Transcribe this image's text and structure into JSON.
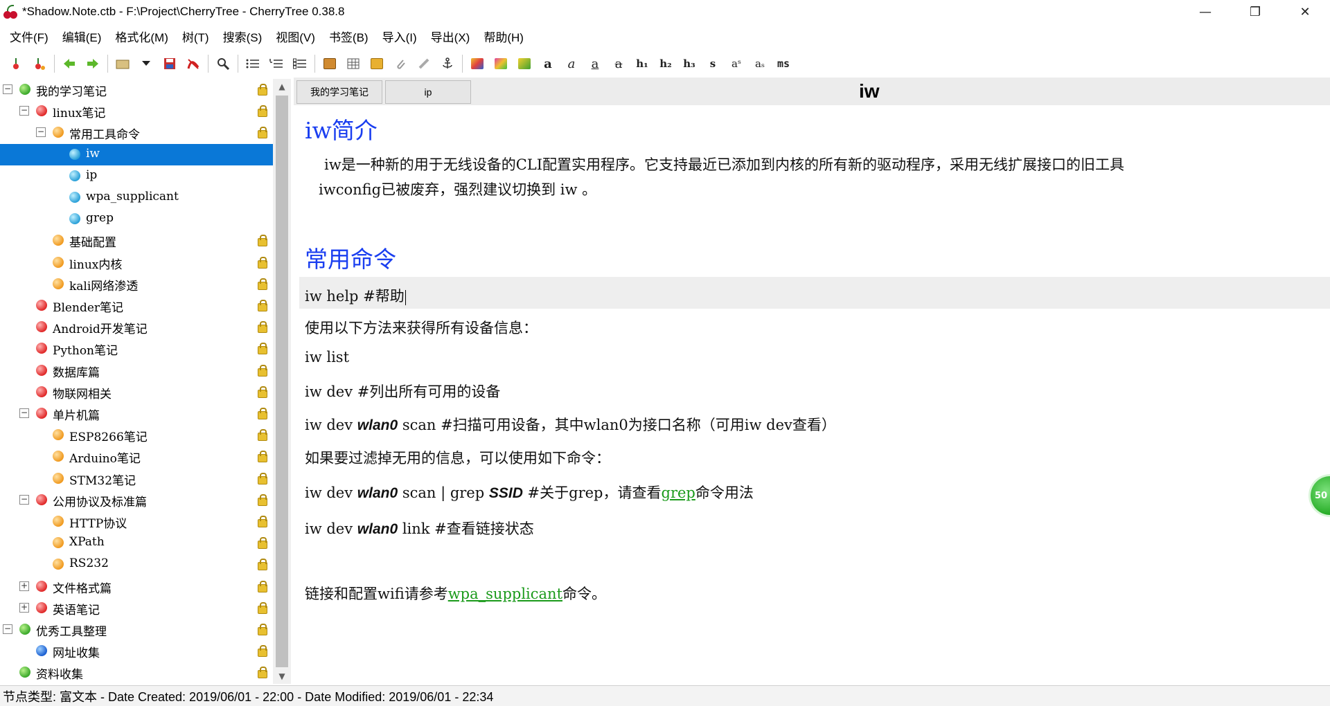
{
  "window": {
    "title": "*Shadow.Note.ctb - F:\\Project\\CherryTree - CherryTree 0.38.8",
    "minimize": "—",
    "restore": "❐",
    "close": "✕"
  },
  "menu": [
    "文件(F)",
    "编辑(E)",
    "格式化(M)",
    "树(T)",
    "搜索(S)",
    "视图(V)",
    "书签(B)",
    "导入(I)",
    "导出(X)",
    "帮助(H)"
  ],
  "toolbar": {
    "icons": [
      "add-node-icon",
      "add-subnode-icon",
      "back-icon",
      "forward-icon",
      "open-icon",
      "dropdown-icon",
      "save-icon",
      "export-pdf-icon",
      "find-icon",
      "bulleted-list-icon",
      "numbered-list-icon",
      "todo-list-icon",
      "image-icon",
      "table-icon",
      "codebox-icon",
      "attach-icon",
      "link-icon",
      "anchor-icon",
      "color-fg-icon",
      "color-bg-icon",
      "remove-format-icon"
    ],
    "format_labels": [
      "a",
      "a",
      "a",
      "a",
      "h₁",
      "h₂",
      "h₃",
      "s",
      "aˢ",
      "aₛ",
      "ms"
    ]
  },
  "tree": [
    {
      "label": "我的学习笔记",
      "icon": "green",
      "level": 0,
      "expander": "⊟",
      "lock": true
    },
    {
      "label": "linux笔记",
      "icon": "red",
      "level": 1,
      "expander": "⊟",
      "lock": true
    },
    {
      "label": "常用工具命令",
      "icon": "orange",
      "level": 2,
      "expander": "⊟",
      "lock": true
    },
    {
      "label": "iw",
      "icon": "teal",
      "level": 3,
      "expander": "",
      "lock": false,
      "selected": true
    },
    {
      "label": "ip",
      "icon": "teal",
      "level": 3,
      "expander": "",
      "lock": false
    },
    {
      "label": "wpa_supplicant",
      "icon": "teal",
      "level": 3,
      "expander": "",
      "lock": false
    },
    {
      "label": "grep",
      "icon": "teal",
      "level": 3,
      "expander": "",
      "lock": false
    },
    {
      "label": "基础配置",
      "icon": "orange",
      "level": 2,
      "expander": "",
      "lock": true
    },
    {
      "label": "linux内核",
      "icon": "orange",
      "level": 2,
      "expander": "",
      "lock": true
    },
    {
      "label": "kali网络渗透",
      "icon": "orange",
      "level": 2,
      "expander": "",
      "lock": true
    },
    {
      "label": "Blender笔记",
      "icon": "red",
      "level": 1,
      "expander": "",
      "lock": true
    },
    {
      "label": "Android开发笔记",
      "icon": "red",
      "level": 1,
      "expander": "",
      "lock": true
    },
    {
      "label": "Python笔记",
      "icon": "red",
      "level": 1,
      "expander": "",
      "lock": true
    },
    {
      "label": "数据库篇",
      "icon": "red",
      "level": 1,
      "expander": "",
      "lock": true
    },
    {
      "label": "物联网相关",
      "icon": "red",
      "level": 1,
      "expander": "",
      "lock": true
    },
    {
      "label": "单片机篇",
      "icon": "red",
      "level": 1,
      "expander": "⊟",
      "lock": true
    },
    {
      "label": "ESP8266笔记",
      "icon": "orange",
      "level": 2,
      "expander": "",
      "lock": true
    },
    {
      "label": "Arduino笔记",
      "icon": "orange",
      "level": 2,
      "expander": "",
      "lock": true
    },
    {
      "label": "STM32笔记",
      "icon": "orange",
      "level": 2,
      "expander": "",
      "lock": true
    },
    {
      "label": "公用协议及标准篇",
      "icon": "red",
      "level": 1,
      "expander": "⊟",
      "lock": true
    },
    {
      "label": "HTTP协议",
      "icon": "orange",
      "level": 2,
      "expander": "",
      "lock": true
    },
    {
      "label": "XPath",
      "icon": "orange",
      "level": 2,
      "expander": "",
      "lock": true
    },
    {
      "label": "RS232",
      "icon": "orange",
      "level": 2,
      "expander": "",
      "lock": true
    },
    {
      "label": "文件格式篇",
      "icon": "red",
      "level": 1,
      "expander": "⊞",
      "lock": true
    },
    {
      "label": "英语笔记",
      "icon": "red",
      "level": 1,
      "expander": "⊞",
      "lock": true
    },
    {
      "label": "优秀工具整理",
      "icon": "green",
      "level": 0,
      "expander": "⊟",
      "lock": true
    },
    {
      "label": "网址收集",
      "icon": "blue",
      "level": 1,
      "expander": "",
      "lock": true
    },
    {
      "label": "资料收集",
      "icon": "green",
      "level": 0,
      "expander": "",
      "lock": true
    }
  ],
  "tabs": [
    "我的学习笔记",
    "ip"
  ],
  "node_title": "iw",
  "content": {
    "h1_intro": "iw简介",
    "intro_line1": "iw是一种新的用于无线设备的CLI配置实用程序。它支持最近已添加到内核的所有新的驱动程序，采用无线扩展接口的旧工具",
    "intro_line2": "iwconfig已被废弃，强烈建议切换到 iw 。",
    "h1_commands": "常用命令",
    "cmd_help": "iw help #帮助",
    "p_get_info": "使用以下方法来获得所有设备信息：",
    "cmd_list": "iw list",
    "cmd_dev": "iw dev #列出所有可用的设备",
    "scan_pre": "iw dev ",
    "scan_iface": "wlan0",
    "scan_post": " scan #扫描可用设备，其中wlan0为接口名称（可用iw dev查看）",
    "p_filter": "如果要过滤掉无用的信息，可以使用如下命令：",
    "grep_pre": "iw dev ",
    "grep_iface": "wlan0",
    "grep_mid": " scan | grep ",
    "grep_ssid": "SSID",
    "grep_post1": " #关于grep，请查看",
    "grep_link": "grep",
    "grep_post2": "命令用法",
    "link_pre": "iw dev ",
    "link_iface": "wlan0",
    "link_post": " link #查看链接状态",
    "wpa_pre": "链接和配置wifi请参考",
    "wpa_link": "wpa_supplicant",
    "wpa_post": "命令。"
  },
  "float_badge": "50",
  "status": "节点类型: 富文本  -  Date Created: 2019/06/01 - 22:00  -  Date Modified: 2019/06/01 - 22:34",
  "colors": {
    "accent": "#0a78d7",
    "heading": "#1a3ef0",
    "link": "#1a9a1a"
  }
}
